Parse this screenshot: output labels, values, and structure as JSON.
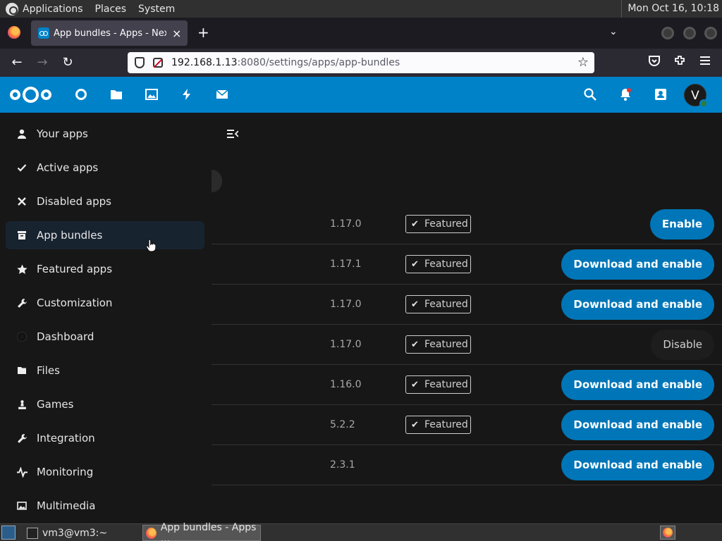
{
  "top_panel": {
    "menus": [
      "Applications",
      "Places",
      "System"
    ],
    "clock": "Mon Oct 16, 10:18"
  },
  "browser": {
    "tab_title": "App bundles - Apps - Nextcloud",
    "tab_close": "×",
    "new_tab": "+",
    "tab_list": "⌄",
    "url_host": "192.168.1.13",
    "url_rest": ":8080/settings/apps/app-bundles",
    "back": "←",
    "forward": "→",
    "reload": "↻",
    "bookmark_star": "☆"
  },
  "header": {
    "apps": [
      "dashboard-icon",
      "files-icon",
      "photos-icon",
      "activity-icon",
      "mail-icon"
    ],
    "avatar_letter": "V",
    "accent": "#0082c9"
  },
  "sidebar": {
    "items": [
      {
        "label": "Your apps",
        "icon": "user-icon",
        "glyph": "👤"
      },
      {
        "label": "Active apps",
        "icon": "check-icon",
        "glyph": "✔"
      },
      {
        "label": "Disabled apps",
        "icon": "close-icon",
        "glyph": "✖"
      },
      {
        "label": "App bundles",
        "icon": "archive-icon",
        "glyph": "▬"
      },
      {
        "label": "Featured apps",
        "icon": "star-icon",
        "glyph": "★"
      },
      {
        "label": "Customization",
        "icon": "wrench-icon",
        "glyph": "🔧"
      },
      {
        "label": "Dashboard",
        "icon": "dashboard-icon",
        "glyph": "●"
      },
      {
        "label": "Files",
        "icon": "folder-icon",
        "glyph": "■"
      },
      {
        "label": "Games",
        "icon": "games-icon",
        "glyph": "♟"
      },
      {
        "label": "Integration",
        "icon": "integration-icon",
        "glyph": "🔧"
      },
      {
        "label": "Monitoring",
        "icon": "monitoring-icon",
        "glyph": "〰"
      },
      {
        "label": "Multimedia",
        "icon": "image-icon",
        "glyph": "▣"
      }
    ],
    "active_index": 3
  },
  "apps": {
    "featured_label": "Featured",
    "rows": [
      {
        "version": "1.17.0",
        "featured": true,
        "action": "Enable",
        "action_type": "primary"
      },
      {
        "version": "1.17.1",
        "featured": true,
        "action": "Download and enable",
        "action_type": "primary"
      },
      {
        "version": "1.17.0",
        "featured": true,
        "action": "Download and enable",
        "action_type": "primary"
      },
      {
        "version": "1.17.0",
        "featured": true,
        "action": "Disable",
        "action_type": "secondary"
      },
      {
        "version": "1.16.0",
        "featured": true,
        "action": "Download and enable",
        "action_type": "primary"
      },
      {
        "version": "5.2.2",
        "featured": true,
        "action": "Download and enable",
        "action_type": "primary"
      },
      {
        "version": "2.3.1",
        "featured": false,
        "action": "Download and enable",
        "action_type": "primary"
      }
    ]
  },
  "taskbar": {
    "items": [
      {
        "label": "vm3@vm3:~",
        "type": "terminal"
      },
      {
        "label": "App bundles - Apps ...",
        "type": "firefox"
      }
    ]
  }
}
